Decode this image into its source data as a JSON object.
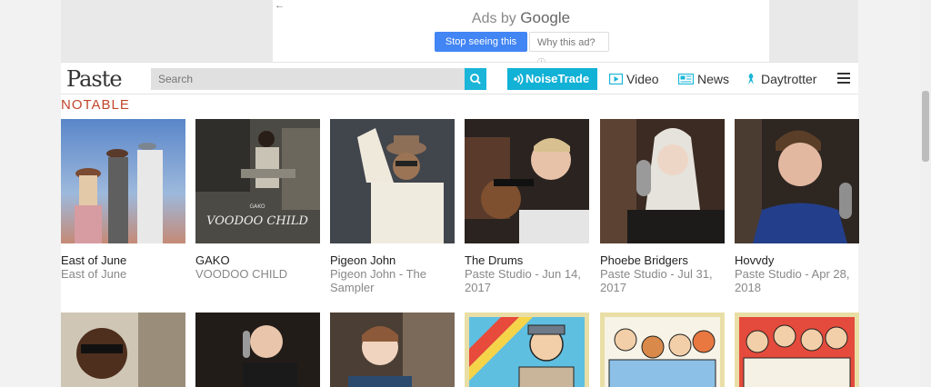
{
  "ad": {
    "back_glyph": "←",
    "ads_by": "Ads by",
    "google": "Google",
    "stop_button": "Stop seeing this ad",
    "why_button": "Why this ad?",
    "info_glyph": "ⓘ"
  },
  "nav": {
    "logo": "Paste",
    "search_placeholder": "Search",
    "noisetrade": "NoiseTrade",
    "video": "Video",
    "news": "News",
    "daytrotter": "Daytrotter"
  },
  "section": {
    "title": "NOTABLE"
  },
  "row1": [
    {
      "title": "East of June",
      "subtitle_line1": "East of June",
      "subtitle_line2": ""
    },
    {
      "title": "GAKO",
      "subtitle_line1": "VOODOO CHILD",
      "subtitle_line2": ""
    },
    {
      "title": "Pigeon John",
      "subtitle_line1": "Pigeon John - The",
      "subtitle_line2": "Sampler"
    },
    {
      "title": "The Drums",
      "subtitle_line1": "Paste Studio - Jun 14,",
      "subtitle_line2": "2017"
    },
    {
      "title": "Phoebe Bridgers",
      "subtitle_line1": "Paste Studio - Jul 31,",
      "subtitle_line2": "2017"
    },
    {
      "title": "Hovvdy",
      "subtitle_line1": "Paste Studio - Apr 28,",
      "subtitle_line2": "2018"
    }
  ],
  "album_art": {
    "gako_line1": "GAKO",
    "gako_line2": "VOODOO CHILD"
  },
  "colors": {
    "accent": "#12b1d6",
    "section_title": "#c1462b"
  }
}
